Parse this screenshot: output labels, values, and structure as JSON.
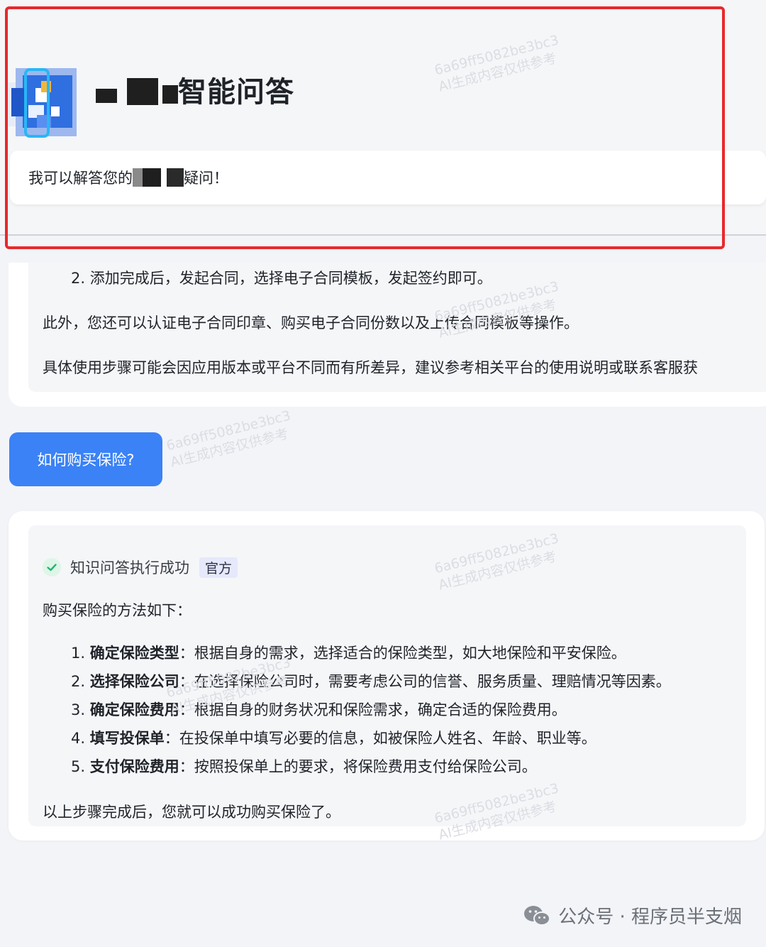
{
  "header": {
    "title_suffix": "智能问答",
    "welcome_prefix": "我可以解答您的",
    "welcome_suffix": "疑问！"
  },
  "previous_answer": {
    "step2": "2. 添加完成后，发起合同，选择电子合同模板，发起签约即可。",
    "extra": "此外，您还可以认证电子合同印章、购买电子合同份数以及上传合同模板等操作。",
    "note": "具体使用步骤可能会因应用版本或平台不同而有所差异，建议参考相关平台的使用说明或联系客服获"
  },
  "user_question": "如何购买保险?",
  "answer": {
    "status": "知识问答执行成功",
    "badge": "官方",
    "intro": "购买保险的方法如下：",
    "steps": [
      {
        "num": "1.",
        "title": "确定保险类型",
        "text": "：根据自身的需求，选择适合的保险类型，如大地保险和平安保险。"
      },
      {
        "num": "2.",
        "title": "选择保险公司",
        "text": "：在选择保险公司时，需要考虑公司的信誉、服务质量、理赔情况等因素。"
      },
      {
        "num": "3.",
        "title": "确定保险费用",
        "text": "：根据自身的财务状况和保险需求，确定合适的保险费用。"
      },
      {
        "num": "4.",
        "title": "填写投保单",
        "text": "：在投保单中填写必要的信息，如被保险人姓名、年龄、职业等。"
      },
      {
        "num": "5.",
        "title": "支付保险费用",
        "text": "：按照投保单上的要求，将保险费用支付给保险公司。"
      }
    ],
    "outro": "以上步骤完成后，您就可以成功购买保险了。"
  },
  "watermark": {
    "line1": "6a69ff5082be3bc3",
    "line2": "AI生成内容仅供参考"
  },
  "footer": {
    "text": "公众号 · 程序员半支烟"
  },
  "colors": {
    "accent_blue": "#3b82f6",
    "frame_red": "#e8292c",
    "success_green": "#22b573"
  }
}
